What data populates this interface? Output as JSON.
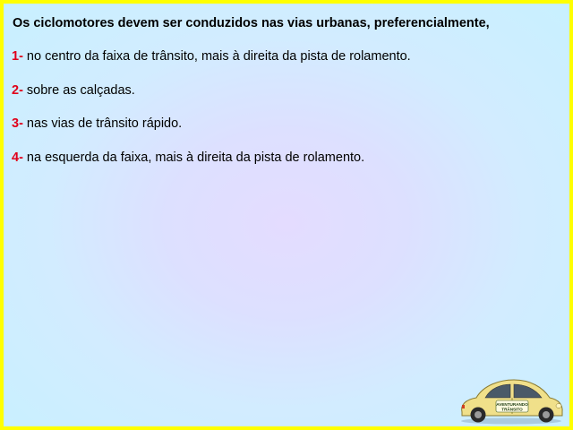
{
  "question": "Os ciclomotores devem ser conduzidos nas vias urbanas, preferencialmente,",
  "options": [
    {
      "num": "1-",
      "text": "no centro da faixa de trânsito, mais à direita da pista de rolamento."
    },
    {
      "num": "2-",
      "text": "sobre as calçadas."
    },
    {
      "num": "3-",
      "text": "nas vias de trânsito rápido."
    },
    {
      "num": "4-",
      "text": "na esquerda da faixa, mais à direita da pista de rolamento."
    }
  ],
  "logo": {
    "line1": "AVENTURANDO",
    "line2": "TRÂNSITO"
  },
  "colors": {
    "border": "#ffff00",
    "option_number": "#e0001a",
    "car_body": "#f0e08a"
  }
}
